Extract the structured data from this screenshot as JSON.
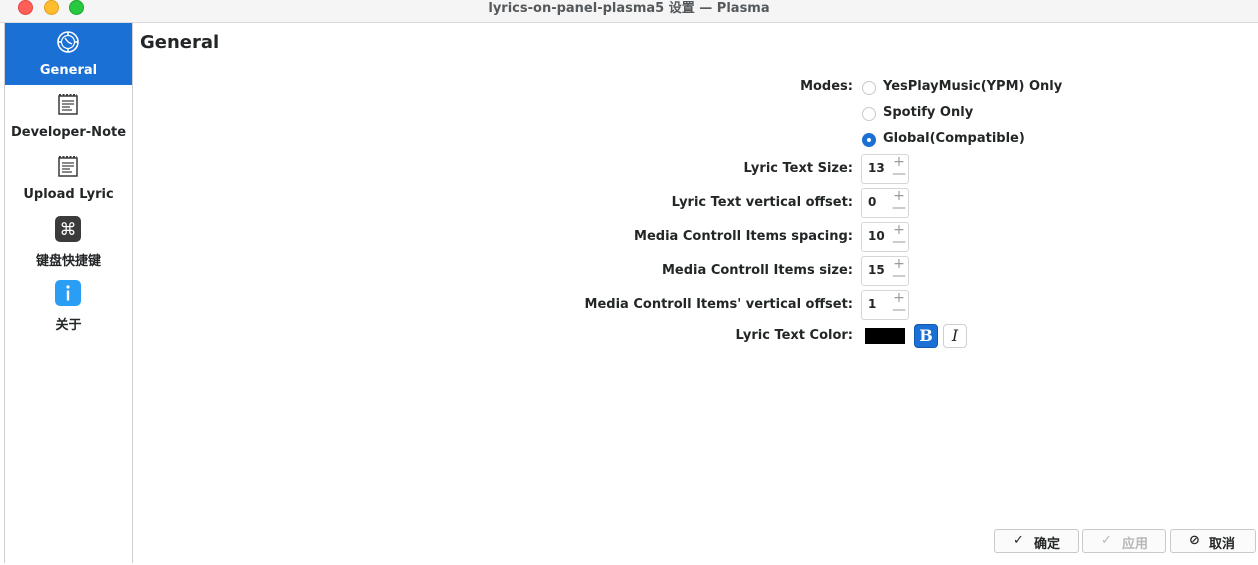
{
  "window": {
    "title": "lyrics-on-panel-plasma5 设置 — Plasma"
  },
  "sidebar": {
    "items": [
      {
        "label": "General",
        "icon": "gear-icon",
        "active": true
      },
      {
        "label": "Developer-Note",
        "icon": "notepad-icon",
        "active": false
      },
      {
        "label": "Upload Lyric",
        "icon": "notepad-icon",
        "active": false
      },
      {
        "label": "键盘快捷键",
        "icon": "command-key-icon",
        "active": false
      },
      {
        "label": "关于",
        "icon": "info-icon",
        "active": false
      }
    ]
  },
  "page": {
    "title": "General"
  },
  "form": {
    "modes_label": "Modes:",
    "modes": [
      {
        "label": "YesPlayMusic(YPM) Only",
        "checked": false
      },
      {
        "label": "Spotify Only",
        "checked": false
      },
      {
        "label": "Global(Compatible)",
        "checked": true
      }
    ],
    "lyric_text_size_label": "Lyric Text Size:",
    "lyric_text_size": "13",
    "lyric_text_vertical_offset_label": "Lyric Text vertical offset:",
    "lyric_text_vertical_offset": "0",
    "media_items_spacing_label": "Media Controll Items spacing:",
    "media_items_spacing": "10",
    "media_items_size_label": "Media Controll Items size:",
    "media_items_size": "15",
    "media_items_vertical_offset_label": "Media Controll Items' vertical offset:",
    "media_items_vertical_offset": "1",
    "lyric_text_color_label": "Lyric Text Color:",
    "lyric_text_color": "#000000",
    "bold_label": "B",
    "italic_label": "I"
  },
  "spin": {
    "up": "+",
    "down": "—"
  },
  "buttons": {
    "ok": "确定",
    "apply": "应用",
    "cancel": "取消"
  },
  "colors": {
    "accent": "#1b70d6"
  }
}
